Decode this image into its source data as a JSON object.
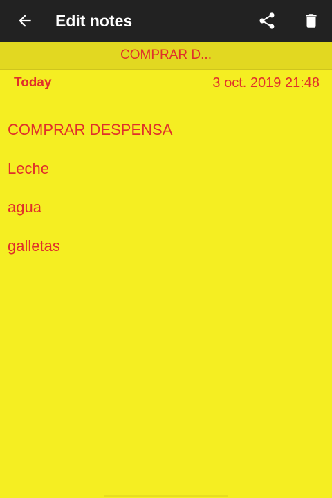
{
  "appbar": {
    "title": "Edit notes",
    "icons": {
      "back": "arrow-left-icon",
      "share": "share-icon",
      "delete": "trash-icon"
    }
  },
  "note": {
    "title_truncated": "COMPRAR D...",
    "day_label": "Today",
    "datetime": "3 oct. 2019 21:48",
    "lines": [
      "COMPRAR DESPENSA",
      "Leche",
      "agua",
      "galletas"
    ]
  },
  "colors": {
    "appbar_bg": "#222222",
    "note_bg": "#f5ee22",
    "title_bar_bg": "#e2d821",
    "text": "#e0302a"
  }
}
